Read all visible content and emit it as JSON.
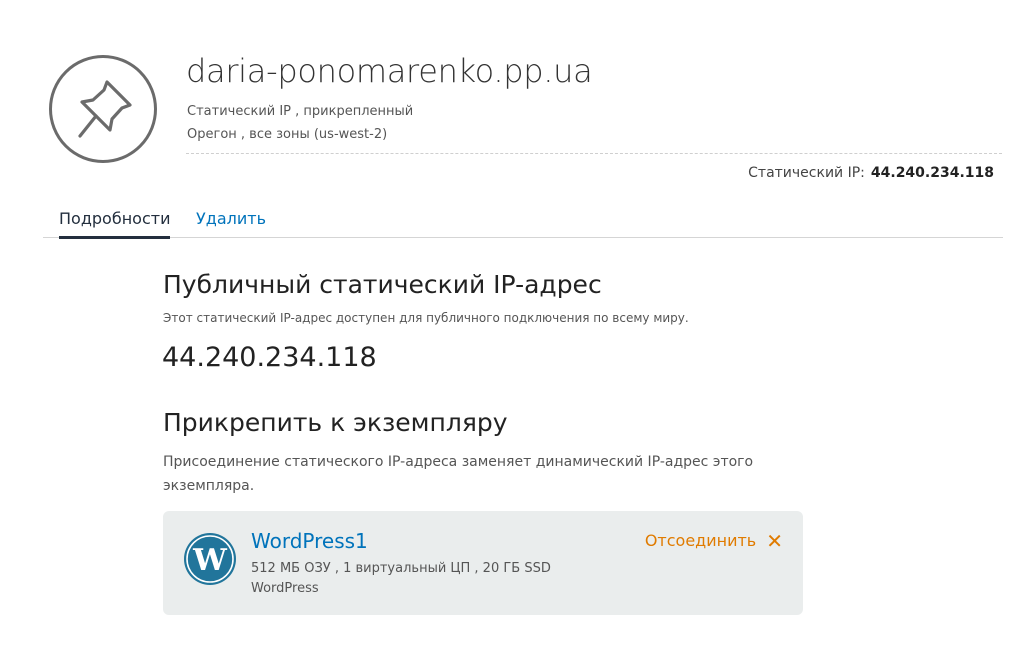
{
  "header": {
    "icon": "pushpin-icon",
    "title": "daria-ponomarenko.pp.ua",
    "subtitle_type": "Статический IP , прикрепленный",
    "subtitle_region": "Орегон , все зоны (us-west-2)",
    "static_ip_label": "Статический IP:",
    "static_ip_value": "44.240.234.118"
  },
  "tabs": [
    {
      "label": "Подробности",
      "active": true
    },
    {
      "label": "Удалить",
      "active": false
    }
  ],
  "public_ip": {
    "heading": "Публичный статический IP-адрес",
    "note": "Этот статический IP-адрес доступен для публичного подключения по всему миру.",
    "value": "44.240.234.118"
  },
  "attach": {
    "heading": "Прикрепить к экземпляру",
    "description": "Присоединение статического IP-адреса заменяет динамический IP-адрес этого экземпляра.",
    "instance": {
      "icon": "wordpress-icon",
      "name": "WordPress1",
      "spec": "512 МБ ОЗУ , 1 виртуальный ЦП , 20 ГБ SSD",
      "platform": "WordPress",
      "detach_label": "Отсоединить",
      "detach_icon": "close-icon"
    }
  },
  "colors": {
    "link": "#0073bb",
    "detach": "#e07b00",
    "card_bg": "#eaeded"
  }
}
